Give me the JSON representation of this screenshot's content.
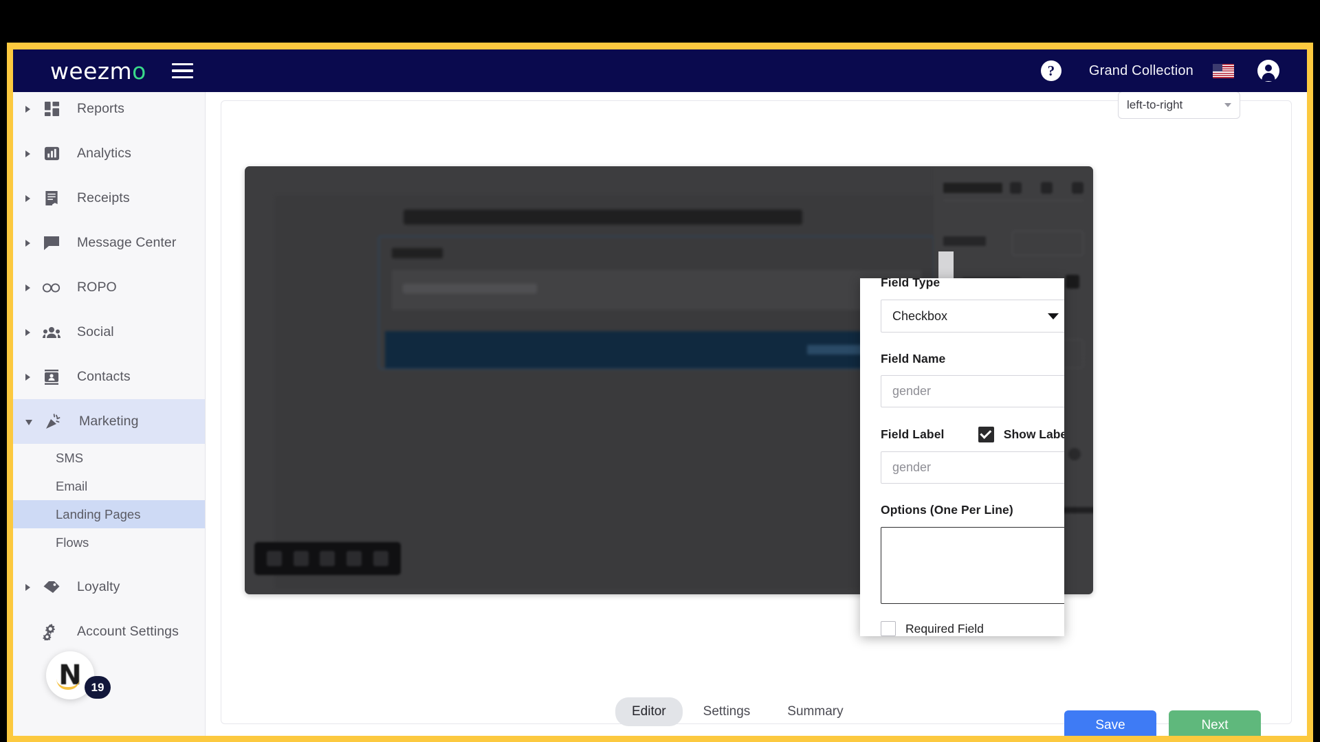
{
  "topbar": {
    "logo_text": "weezm",
    "logo_accent": "o",
    "menu_icon": "hamburger-menu-icon",
    "help_label": "?",
    "org_name": "Grand Collection",
    "flag": "us-flag-icon",
    "account_icon": "account-avatar-icon"
  },
  "sidebar": {
    "items": [
      {
        "label": "Reports",
        "icon": "dashboard-grid-icon",
        "expanded": false
      },
      {
        "label": "Analytics",
        "icon": "bar-chart-icon",
        "expanded": false
      },
      {
        "label": "Receipts",
        "icon": "receipt-icon",
        "expanded": false
      },
      {
        "label": "Message Center",
        "icon": "chat-bubble-icon",
        "expanded": false
      },
      {
        "label": "ROPO",
        "icon": "infinity-icon",
        "expanded": false
      },
      {
        "label": "Social",
        "icon": "people-group-icon",
        "expanded": false
      },
      {
        "label": "Contacts",
        "icon": "contact-card-icon",
        "expanded": false
      },
      {
        "label": "Marketing",
        "icon": "megaphone-confetti-icon",
        "expanded": true
      },
      {
        "label": "Loyalty",
        "icon": "tag-icon",
        "expanded": false
      },
      {
        "label": "Account Settings",
        "icon": "gears-icon",
        "expanded": false
      }
    ],
    "marketing_subitems": [
      {
        "label": "SMS",
        "active": false
      },
      {
        "label": "Email",
        "active": false
      },
      {
        "label": "Landing Pages",
        "active": true
      },
      {
        "label": "Flows",
        "active": false
      }
    ],
    "nudge": {
      "mark": "N",
      "badge_count": "19"
    }
  },
  "content": {
    "direction_select": {
      "value": "left-to-right"
    }
  },
  "field_modal": {
    "field_type_label": "Field Type",
    "field_type_value": "Checkbox",
    "field_name_label": "Field Name",
    "field_name_value": "",
    "field_name_placeholder": "gender",
    "field_label_label": "Field Label",
    "show_label_text": "Show Label",
    "show_label_checked": true,
    "field_label_value": "",
    "field_label_placeholder": "gender",
    "options_label": "Options (One Per Line)",
    "options_value": "",
    "required_field_label": "Required Field",
    "required_field_checked": false
  },
  "footer": {
    "tabs": [
      {
        "label": "Editor",
        "active": true
      },
      {
        "label": "Settings",
        "active": false
      },
      {
        "label": "Summary",
        "active": false
      }
    ],
    "save_label": "Save",
    "next_label": "Next"
  },
  "colors": {
    "navy": "#0A0A4E",
    "accent_green": "#39D98A",
    "frame_yellow": "#FCC93F",
    "save_blue": "#3E7BF5",
    "next_green": "#5FB87C",
    "active_sidebar": "#CEDAF5"
  }
}
